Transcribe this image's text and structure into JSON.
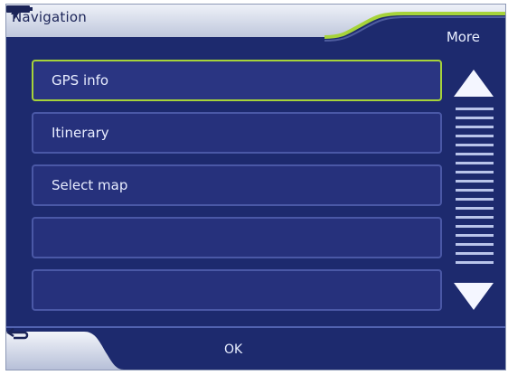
{
  "header": {
    "title": "Navigation",
    "more_label": "More",
    "power_icon": "lightning-icon",
    "battery_icon": "battery-icon"
  },
  "list": {
    "items": [
      {
        "label": "GPS info"
      },
      {
        "label": "Itinerary"
      },
      {
        "label": "Select map"
      },
      {
        "label": ""
      },
      {
        "label": ""
      }
    ]
  },
  "scrollbar": {
    "up_icon": "arrow-up-icon",
    "down_icon": "arrow-down-icon"
  },
  "footer": {
    "back_icon": "back-arrow-icon",
    "ok_label": "OK"
  },
  "colors": {
    "background": "#1d2a6e",
    "accent_green": "#a6d33a",
    "item_border": "#4a58a6",
    "text": "#e8edff"
  }
}
